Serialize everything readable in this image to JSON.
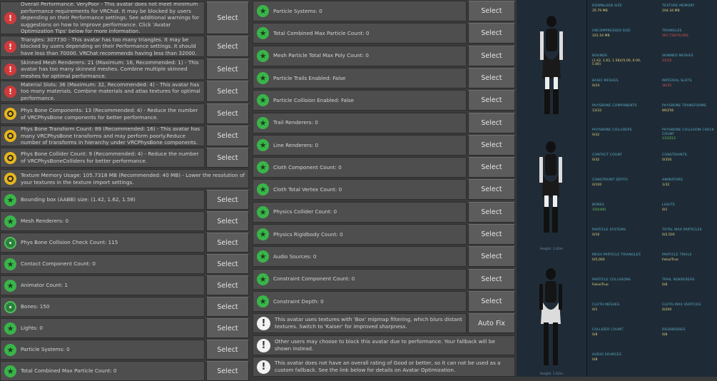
{
  "left_rows": [
    {
      "severity": "error",
      "text": "Overall Performance: VeryPoor - This avatar does not meet minimum performance requirements for VRChat. It may be blocked by users depending on their Performance settings. See additional warnings for suggestions on how to improve performance. Click 'Avatar Optimization Tips' below for more information.",
      "button": "Select"
    },
    {
      "severity": "error",
      "text": "Triangles: 307730 - This avatar has too many triangles. It may be blocked by users depending on their Performance settings. It should have less than 70000. VRChat recommends having less than 32000.",
      "button": "Select"
    },
    {
      "severity": "error",
      "text": "Skinned Mesh Renderers: 21 (Maximum: 16, Recommended: 1) - This avatar has too many skinned meshes. Combine multiple skinned meshes for optimal performance.",
      "button": "Select"
    },
    {
      "severity": "error",
      "text": "Material Slots: 36 (Maximum: 32, Recommended: 4) - This avatar has too many materials. Combine materials and atlas textures for optimal performance.",
      "button": "Select"
    },
    {
      "severity": "warn",
      "text": "Phys Bone Components: 13 (Recommended: 4) - Reduce the number of VRCPhysBone components for better performance.",
      "button": "Select"
    },
    {
      "severity": "warn",
      "text": "Phys Bone Transform Count: 89 (Recommended: 16) - This avatar has many VRCPhysBone transforms and may perform poorly.Reduce number of transforms in hierarchy under VRCPhysBone components.",
      "button": "Select"
    },
    {
      "severity": "warn",
      "text": "Phys Bone Collider Count: 9 (Recommended: 4) - Reduce the number of VRCPhysBoneColliders for better performance.",
      "button": "Select"
    },
    {
      "severity": "warn",
      "text": "Texture Memory Usage: 105.7318 MB (Recommended: 40 MB) - Lower the resolution of your textures in the texture import settings.",
      "button": ""
    },
    {
      "severity": "ok",
      "text": "Bounding box (AABB) size: (1.42, 1.62, 1.58)",
      "button": "Select"
    },
    {
      "severity": "ok",
      "text": "Mesh Renderers: 0",
      "button": "Select"
    },
    {
      "severity": "info",
      "text": "Phys Bone Collision Check Count: 115",
      "button": "Select"
    },
    {
      "severity": "ok",
      "text": "Contact Component Count: 0",
      "button": "Select"
    },
    {
      "severity": "ok",
      "text": "Animator Count: 1",
      "button": "Select"
    },
    {
      "severity": "info",
      "text": "Bones: 150",
      "button": "Select"
    },
    {
      "severity": "ok",
      "text": "Lights: 0",
      "button": "Select"
    },
    {
      "severity": "ok",
      "text": "Particle Systems: 0",
      "button": "Select"
    },
    {
      "severity": "ok",
      "text": "Total Combined Max Particle Count: 0",
      "button": "Select"
    }
  ],
  "mid_rows": [
    {
      "severity": "ok",
      "text": "Particle Systems: 0",
      "button": "Select"
    },
    {
      "severity": "ok",
      "text": "Total Combined Max Particle Count: 0",
      "button": "Select"
    },
    {
      "severity": "ok",
      "text": "Mesh Particle Total Max Poly Count: 0",
      "button": "Select"
    },
    {
      "severity": "ok",
      "text": "Particle Trails Enabled: False",
      "button": "Select"
    },
    {
      "severity": "ok",
      "text": "Particle Collision Enabled: False",
      "button": "Select"
    },
    {
      "severity": "ok",
      "text": "Trail Renderers: 0",
      "button": "Select"
    },
    {
      "severity": "ok",
      "text": "Line Renderers: 0",
      "button": "Select"
    },
    {
      "severity": "ok",
      "text": "Cloth Component Count: 0",
      "button": "Select"
    },
    {
      "severity": "ok",
      "text": "Cloth Total Vertex Count: 0",
      "button": "Select"
    },
    {
      "severity": "ok",
      "text": "Physics Collider Count: 0",
      "button": "Select"
    },
    {
      "severity": "ok",
      "text": "Physics Rigidbody Count: 0",
      "button": "Select"
    },
    {
      "severity": "ok",
      "text": "Audio Sources: 0",
      "button": "Select"
    },
    {
      "severity": "ok",
      "text": "Constraint Component Count: 0",
      "button": "Select"
    },
    {
      "severity": "ok",
      "text": "Constraint Depth: 0",
      "button": "Select"
    },
    {
      "severity": "note",
      "text": "This avatar uses textures with 'Box' mipmap filtering, which blurs distant textures. Switch to 'Kaiser' for improved sharpness.",
      "button": "Auto Fix"
    },
    {
      "severity": "note",
      "text": "Other users may choose to block this avatar due to performance. Your fallback will be shown instead.",
      "button": ""
    },
    {
      "severity": "note",
      "text": "This avatar does not have an overall rating of Good or better, so it can not be used as a custom fallback. See the link below for details on Avatar Optimization.",
      "button": ""
    }
  ],
  "previews": [
    {
      "caption": ""
    },
    {
      "caption": "Height: 1.42m"
    },
    {
      "caption": "Height: 1.42m"
    }
  ],
  "stats_top": [
    {
      "label": "Download Size",
      "value": "35.79 MB",
      "color": "#e8d27a"
    },
    {
      "label": "Texture Memory",
      "value": "104.34 MB",
      "color": "#e8d27a"
    },
    {
      "label": "Uncompressed Size",
      "value": "101.16 MB",
      "color": "#e8d27a"
    },
    {
      "label": "Triangles",
      "value": "307,730/70,000",
      "color": "#e05252"
    },
    {
      "label": "Bounds",
      "value": "(1.42, 1.62, 1.58)/(5.00, 6.00, 5.00)",
      "color": "#e8d27a"
    },
    {
      "label": "Skinned Meshes",
      "value": "21/16",
      "color": "#e05252"
    },
    {
      "label": "Basic Meshes",
      "value": "0/24",
      "color": "#e8d27a"
    },
    {
      "label": "Material Slots",
      "value": "36/32",
      "color": "#e05252"
    },
    {
      "label": "PhysBone Components",
      "value": "13/32",
      "color": "#e8d27a"
    },
    {
      "label": "PhysBone Transforms",
      "value": "89/256",
      "color": "#e8d27a"
    }
  ],
  "stats_bottom": [
    {
      "label": "PhysBone Colliders",
      "value": "9/32",
      "color": "#e8d27a"
    },
    {
      "label": "PhysBone Collision Check Count",
      "value": "115/512",
      "color": "#6cc45c"
    },
    {
      "label": "Contact Count",
      "value": "0/32",
      "color": "#e8d27a"
    },
    {
      "label": "Constraints",
      "value": "0/350",
      "color": "#e8d27a"
    },
    {
      "label": "Constraint Depth",
      "value": "0/100",
      "color": "#e8d27a"
    },
    {
      "label": "Animators",
      "value": "1/32",
      "color": "#e8d27a"
    },
    {
      "label": "Bones",
      "value": "150/400",
      "color": "#6cc45c"
    },
    {
      "label": "Lights",
      "value": "0/1",
      "color": "#e8d27a"
    },
    {
      "label": "Particle Systems",
      "value": "0/16",
      "color": "#e8d27a"
    },
    {
      "label": "Total Max Particles",
      "value": "0/2,500",
      "color": "#e8d27a"
    },
    {
      "label": "Mesh Particle Triangles",
      "value": "0/5,000",
      "color": "#e8d27a"
    },
    {
      "label": "Particle Trails",
      "value": "False/True",
      "color": "#e8d27a"
    },
    {
      "label": "Particle Collisions",
      "value": "False/True",
      "color": "#e8d27a"
    },
    {
      "label": "Trail Renderers",
      "value": "0/8",
      "color": "#e8d27a"
    },
    {
      "label": "Cloth Meshes",
      "value": "0/1",
      "color": "#e8d27a"
    },
    {
      "label": "Cloth Max Vertices",
      "value": "0/200",
      "color": "#e8d27a"
    },
    {
      "label": "Collider Count",
      "value": "0/8",
      "color": "#e8d27a"
    },
    {
      "label": "Rigidbodies",
      "value": "0/8",
      "color": "#e8d27a"
    },
    {
      "label": "Audio Sources",
      "value": "0/8",
      "color": "#e8d27a"
    }
  ]
}
